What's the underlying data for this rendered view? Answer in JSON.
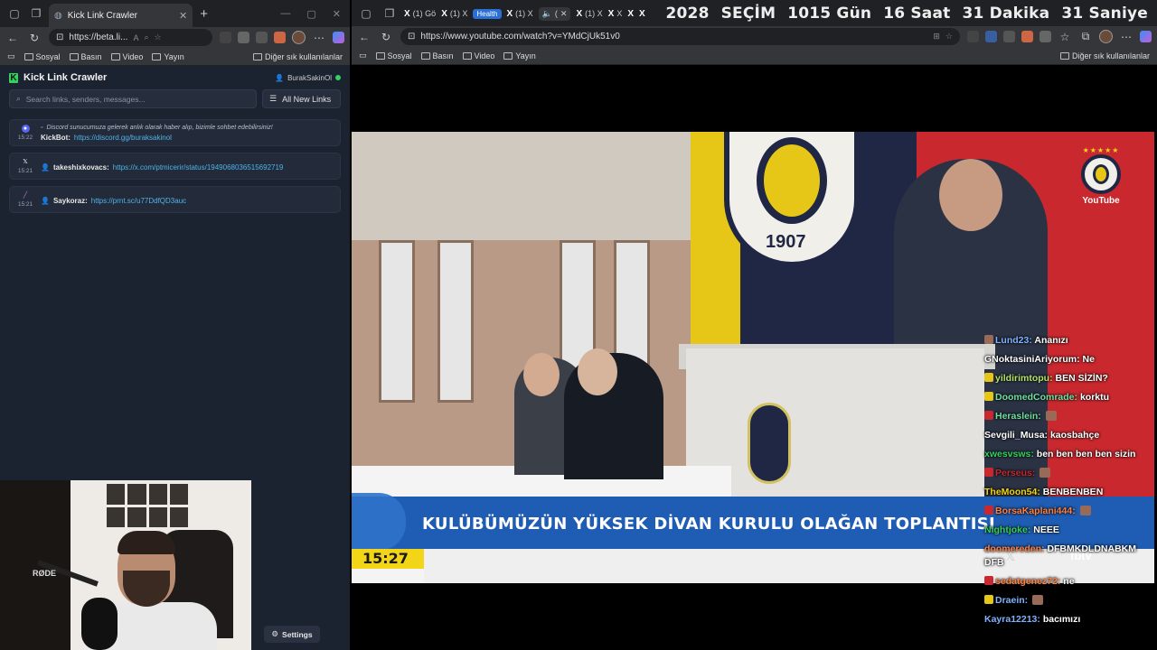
{
  "left_window": {
    "tab_title": "Kick Link Crawler",
    "url": "https://beta.li...",
    "bookmarks": [
      "Sosyal",
      "Basın",
      "Video",
      "Yayın"
    ],
    "bookmarks_other": "Diğer sık kullanılanlar",
    "app": {
      "title": "Kick Link Crawler",
      "username": "BurakSakinOl",
      "search_placeholder": "Search links, senders, messages...",
      "filter_label": "All New Links",
      "settings_label": "Settings",
      "entries": [
        {
          "time": "15:22",
          "message": "Discord sunucumuza gelerek anlık olarak haber alıp, bizimle sohbet edebilirsiniz!",
          "sender": "KickBot:",
          "link": "https://discord.gg/buraksakinol",
          "platform": "discord-icon"
        },
        {
          "time": "15:21",
          "message": "",
          "sender": "takeshixkovacs:",
          "link": "https://x.com/ptmicerir/status/1949068036515692719",
          "platform": "x-icon"
        },
        {
          "time": "15:21",
          "message": "",
          "sender": "Saykoraz:",
          "link": "https://prnt.sc/u77DdfQD3auc",
          "platform": "lightshot-icon"
        }
      ]
    }
  },
  "right_window": {
    "tabs": [
      {
        "label": "(1) Gö"
      },
      {
        "label": "(1) X"
      },
      {
        "label": "Health"
      },
      {
        "label": "(1) X"
      },
      {
        "label": "("
      },
      {
        "label": "(1) X"
      },
      {
        "label": "X"
      },
      {
        "label": "X"
      },
      {
        "label": "X"
      }
    ],
    "countdown": {
      "label1": "2028",
      "label2": "SEÇİM",
      "days": "1015 Gün",
      "hours": "16 Saat",
      "minutes": "31 Dakika",
      "seconds": "31 Saniye"
    },
    "url": "https://www.youtube.com/watch?v=YMdCjUk51v0",
    "bookmarks": [
      "Sosyal",
      "Basın",
      "Video",
      "Yayın"
    ],
    "bookmarks_other": "Diğer sık kullanılanlar",
    "video": {
      "lower_third": "KULÜBÜMÜZÜN YÜKSEK DİVAN KURULU OLAĞAN TOPLANTISI",
      "clock": "15:27",
      "crest_year": "1907",
      "channel_logo_text": "YouTube",
      "watermark": "fbtv"
    },
    "chat": [
      {
        "user": "Lund23:",
        "msg": "Ananızı",
        "color": "#7fb2ff",
        "badge": "#9a6a58"
      },
      {
        "user": "GNoktasiniAriyorum:",
        "msg": "Ne",
        "color": "#ffffff",
        "badge": ""
      },
      {
        "user": "yildirimtopu:",
        "msg": "BEN SİZİN?",
        "color": "#b6e36a",
        "badge": "#e6c717"
      },
      {
        "user": "DoomedComrade:",
        "msg": "korktu",
        "color": "#6fe0a0",
        "badge": "#e6c717"
      },
      {
        "user": "Heraslein:",
        "msg": "",
        "color": "#6fe0a0",
        "badge": "#c8282e"
      },
      {
        "user": "Sevgili_Musa:",
        "msg": "kaosbahçe",
        "color": "#ffffff",
        "badge": ""
      },
      {
        "user": "xwesvsws:",
        "msg": "ben ben ben ben sizin",
        "color": "#35d060",
        "badge": ""
      },
      {
        "user": "Perseus:",
        "msg": "",
        "color": "#c8282e",
        "badge": "#c8282e"
      },
      {
        "user": "TheMoon54:",
        "msg": "BENBENBEN",
        "color": "#f2d517",
        "badge": ""
      },
      {
        "user": "BorsaKaplani444:",
        "msg": "",
        "color": "#ff8040",
        "badge": "#c8282e"
      },
      {
        "user": "Nightjoke:",
        "msg": "NEEE",
        "color": "#35d060",
        "badge": ""
      },
      {
        "user": "doomereden:",
        "msg": "DFBMKDLDNABKM DFB",
        "color": "#ff8040",
        "badge": ""
      },
      {
        "user": "sedatgenez72:",
        "msg": "ne",
        "color": "#ff8040",
        "badge": "#c8282e"
      },
      {
        "user": "Draein:",
        "msg": "",
        "color": "#7fb2ff",
        "badge": "#e6c717"
      },
      {
        "user": "Kayra12213:",
        "msg": "bacımızı",
        "color": "#7fb2ff",
        "badge": ""
      }
    ]
  }
}
